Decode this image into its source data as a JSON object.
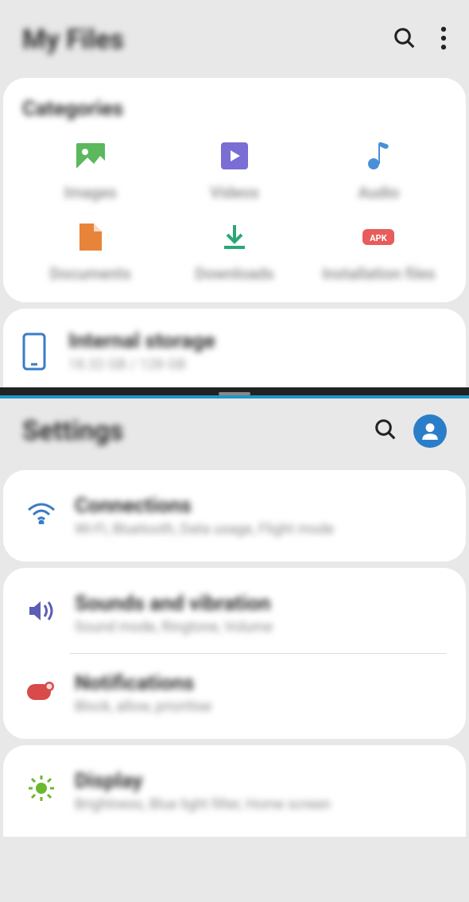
{
  "top_app": {
    "title": "My Files",
    "section": "Categories",
    "categories": [
      {
        "label": "Images",
        "icon": "image-icon",
        "color": "#5bb85b"
      },
      {
        "label": "Videos",
        "icon": "video-icon",
        "color": "#6a5acd"
      },
      {
        "label": "Audio",
        "icon": "audio-icon",
        "color": "#4a90d9"
      },
      {
        "label": "Documents",
        "icon": "document-icon",
        "color": "#e8833a"
      },
      {
        "label": "Downloads",
        "icon": "download-icon",
        "color": "#2aa876"
      },
      {
        "label": "Installation files",
        "icon": "apk-icon",
        "color": "#e85c5c"
      }
    ],
    "storage": {
      "title": "Internal storage",
      "sub": "18.32 GB / 128 GB"
    }
  },
  "bottom_app": {
    "title": "Settings",
    "items": [
      {
        "title": "Connections",
        "sub": "Wi-Fi, Bluetooth, Data usage, Flight mode",
        "icon": "wifi-icon",
        "color": "#3b7bc8"
      },
      {
        "title": "Sounds and vibration",
        "sub": "Sound mode, Ringtone, Volume",
        "icon": "sound-icon",
        "color": "#5c5db5"
      },
      {
        "title": "Notifications",
        "sub": "Block, allow, prioritise",
        "icon": "notification-icon",
        "color": "#d94a4a"
      },
      {
        "title": "Display",
        "sub": "Brightness, Blue light filter, Home screen",
        "icon": "display-icon",
        "color": "#6ab82f"
      }
    ]
  }
}
